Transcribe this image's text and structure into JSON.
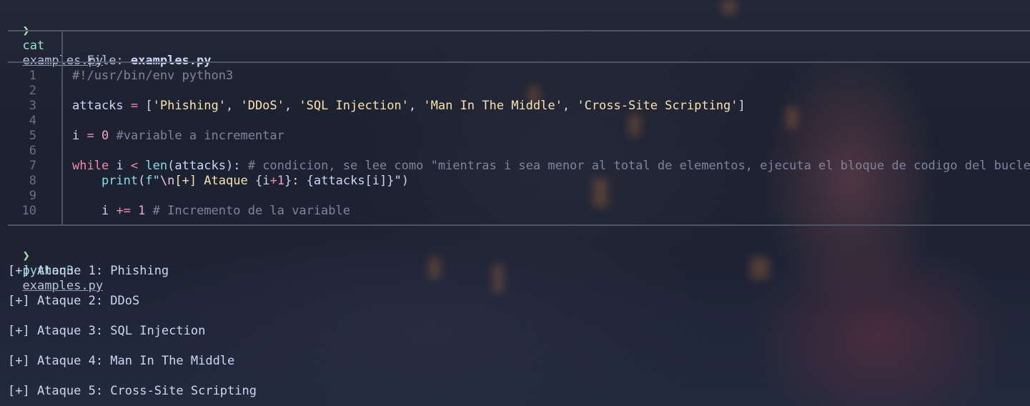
{
  "prompt_symbol": "❯",
  "first_command": {
    "cmd": "cat",
    "arg": "examples.py"
  },
  "file_view": {
    "file_label": "File: ",
    "file_name": "examples.py",
    "line_numbers": [
      "1",
      "2",
      "3",
      "4",
      "5",
      "6",
      "7",
      "8",
      "9",
      "10"
    ],
    "lines": {
      "l1": "#!/usr/bin/env python3",
      "l3": {
        "a": "attacks ",
        "b": "=",
        "c": " [",
        "s1": "'Phishing'",
        "s2": "'DDoS'",
        "s3": "'SQL Injection'",
        "s4": "'Man In The Middle'",
        "s5": "'Cross-Site Scripting'",
        "sep": ", ",
        "end": "]"
      },
      "l5": {
        "a": "i ",
        "b": "=",
        "c": " ",
        "num": "0",
        "comment": " #variable a incrementar"
      },
      "l7": {
        "kw": "while",
        "a": " i ",
        "op": "<",
        "sp": " ",
        "fn": "len",
        "b": "(attacks): ",
        "comment": "# condicion, se lee como \"mientras i sea menor al total de elementos, ejecuta el bloque de codigo del bucle.\""
      },
      "l8": {
        "indent": "    ",
        "fn": "print",
        "a": "(",
        "pre": "f\"",
        "esc": "\\n",
        "s1": "[+] Ataque ",
        "b1": "{i",
        "op": "+",
        "num": "1",
        "b2": "}",
        "s2": ": ",
        "b3": "{attacks[i]}",
        "s3": "\"",
        "close": ")"
      },
      "l10": {
        "indent": "    ",
        "a": "i ",
        "op": "+=",
        "sp": " ",
        "num": "1",
        "comment": " # Incremento de la variable"
      }
    }
  },
  "second_command": {
    "cmd": "python3",
    "arg": "examples.py"
  },
  "output_lines": [
    "[+] Ataque 1: Phishing",
    "[+] Ataque 2: DDoS",
    "[+] Ataque 3: SQL Injection",
    "[+] Ataque 4: Man In The Middle",
    "[+] Ataque 5: Cross-Site Scripting"
  ]
}
